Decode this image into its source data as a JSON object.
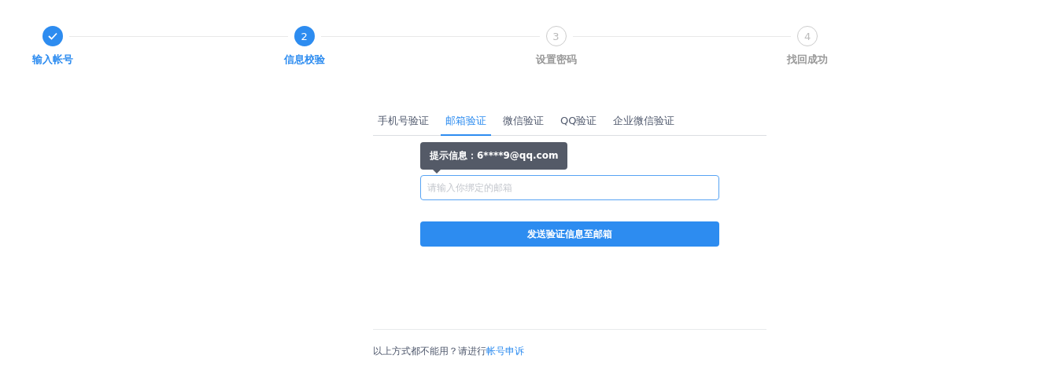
{
  "steps": [
    {
      "label": "输入帐号",
      "kind": "done"
    },
    {
      "number": "2",
      "label": "信息校验",
      "kind": "active"
    },
    {
      "number": "3",
      "label": "设置密码",
      "kind": "wait"
    },
    {
      "number": "4",
      "label": "找回成功",
      "kind": "wait"
    }
  ],
  "tabs": [
    {
      "label": "手机号验证",
      "selected": false
    },
    {
      "label": "邮箱验证",
      "selected": true
    },
    {
      "label": "微信验证",
      "selected": false
    },
    {
      "label": "QQ验证",
      "selected": false
    },
    {
      "label": "企业微信验证",
      "selected": false
    }
  ],
  "tooltip": "提示信息：6****9@qq.com",
  "email_field": {
    "placeholder": "请输入你绑定的邮箱"
  },
  "submit_button": "发送验证信息至邮箱",
  "footer": {
    "text": "以上方式都不能用？请进行",
    "link": "帐号申诉"
  }
}
